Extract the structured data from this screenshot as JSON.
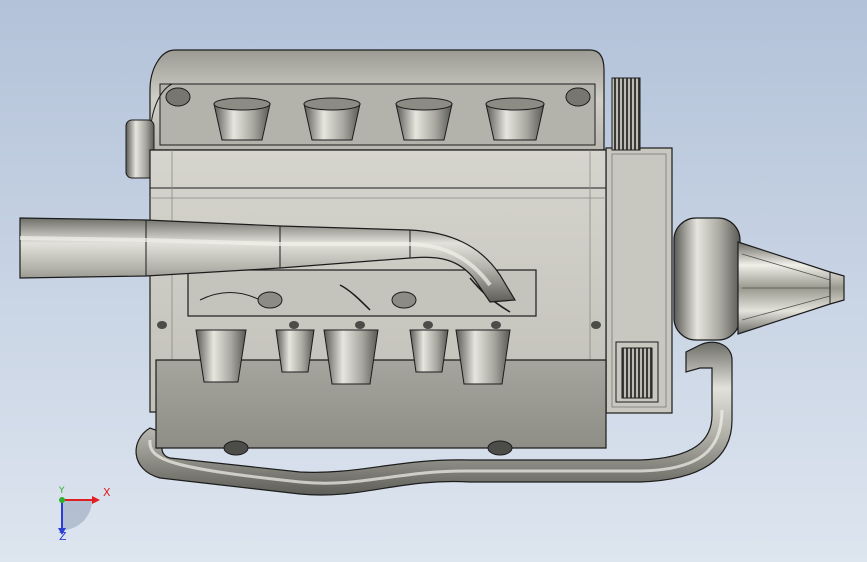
{
  "viewport": {
    "background_top": "#b3c2d9",
    "background_bottom": "#dde5ef"
  },
  "model": {
    "metal_light": "#d4d4cc",
    "metal_mid": "#aaa9a0",
    "metal_dark": "#6a6a64",
    "outline": "#1c1c1c"
  },
  "triad": {
    "x_label": "X",
    "y_label": "Y",
    "z_label": "Z",
    "x_color": "#e02020",
    "y_color": "#2fb02f",
    "z_color": "#2b3fd6"
  }
}
